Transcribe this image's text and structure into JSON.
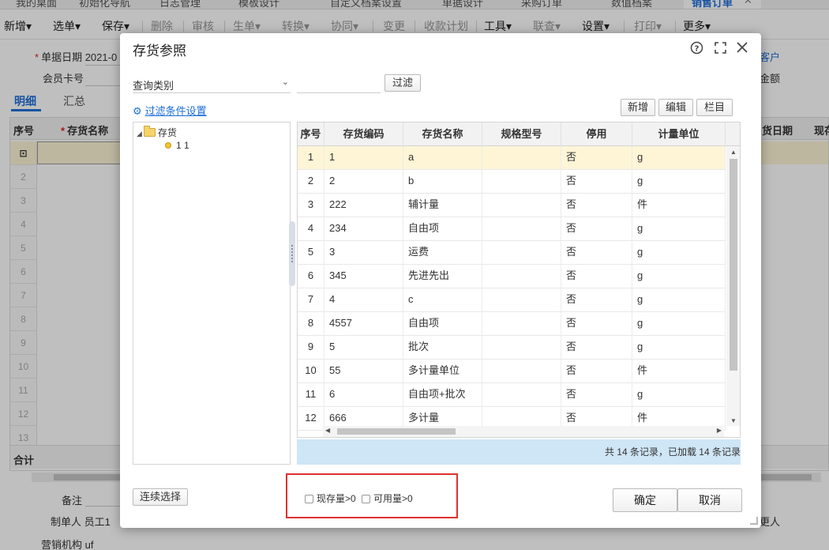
{
  "app_tabs": [
    "我的桌面",
    "初始化导航",
    "日志管理",
    "模板设计",
    "自定义档案设置",
    "单据设计",
    "采购订单",
    "数值档案",
    "销售订单"
  ],
  "toolbar": {
    "items": [
      {
        "label": "新增",
        "caret": "▾",
        "disabled": false
      },
      {
        "label": "选单",
        "caret": "▾",
        "disabled": false
      },
      {
        "label": "保存",
        "caret": "▾",
        "disabled": false
      },
      {
        "label": "删除",
        "caret": "",
        "disabled": true
      },
      {
        "label": "审核",
        "caret": "",
        "disabled": true
      },
      {
        "label": "生单",
        "caret": "▾",
        "disabled": true
      },
      {
        "label": "转换",
        "caret": "▾",
        "disabled": true
      },
      {
        "label": "协同",
        "caret": "▾",
        "disabled": true
      },
      {
        "label": "变更",
        "caret": "",
        "disabled": true
      },
      {
        "label": "收款计划",
        "caret": "",
        "disabled": true
      },
      {
        "label": "工具",
        "caret": "▾",
        "disabled": false
      },
      {
        "label": "联查",
        "caret": "▾",
        "disabled": true
      },
      {
        "label": "设置",
        "caret": "▾",
        "disabled": false
      },
      {
        "label": "打印",
        "caret": "▾",
        "disabled": true
      },
      {
        "label": "更多",
        "caret": "▾",
        "disabled": false
      }
    ]
  },
  "form": {
    "date_label": "单据日期",
    "date_value": "2021-0",
    "member_card_label": "会员卡号",
    "right_label_1": "客户",
    "right_label_2": "金额"
  },
  "subtabs": [
    "明细",
    "汇总"
  ],
  "grid": {
    "col_seq": "序号",
    "col_name": "存货名称",
    "col_date": "货日期",
    "col_stock": "现存",
    "row_numbers": [
      "2",
      "3",
      "4",
      "5",
      "6",
      "7",
      "8",
      "9",
      "10",
      "11",
      "12",
      "13"
    ],
    "total_label": "合计"
  },
  "footer": {
    "remark_label": "备注",
    "creator_label": "制单人",
    "creator_value": "员工1",
    "org_label": "营销机构",
    "org_value": "uf",
    "right_label": "更人"
  },
  "dialog": {
    "title": "存货参照",
    "query_select": "查询类别",
    "filter_button": "过滤",
    "filter_settings_link": "过滤条件设置",
    "buttons": {
      "add": "新增",
      "edit": "编辑",
      "columns": "栏目"
    },
    "tree": {
      "root": "存货",
      "child": "1 1"
    },
    "table": {
      "headers": [
        "序号",
        "存货编码",
        "存货名称",
        "规格型号",
        "停用",
        "计量单位"
      ],
      "rows": [
        [
          "1",
          "1",
          "a",
          "",
          "否",
          "g"
        ],
        [
          "2",
          "2",
          "b",
          "",
          "否",
          "g"
        ],
        [
          "3",
          "222",
          "辅计量",
          "",
          "否",
          "件"
        ],
        [
          "4",
          "234",
          "自由项",
          "",
          "否",
          "g"
        ],
        [
          "5",
          "3",
          "运费",
          "",
          "否",
          "g"
        ],
        [
          "6",
          "345",
          "先进先出",
          "",
          "否",
          "g"
        ],
        [
          "7",
          "4",
          "c",
          "",
          "否",
          "g"
        ],
        [
          "8",
          "4557",
          "自由项",
          "",
          "否",
          "g"
        ],
        [
          "9",
          "5",
          "批次",
          "",
          "否",
          "g"
        ],
        [
          "10",
          "55",
          "多计量单位",
          "",
          "否",
          "件"
        ],
        [
          "11",
          "6",
          "自由项+批次",
          "",
          "否",
          "g"
        ],
        [
          "12",
          "666",
          "多计量",
          "",
          "否",
          "件"
        ]
      ]
    },
    "status_text": "共 14 条记录，已加载 14 条记录",
    "continuous_select": "连续选择",
    "checkbox_stock": "现存量>0",
    "checkbox_available": "可用量>0",
    "confirm": "确定",
    "cancel": "取消"
  },
  "colors": {
    "accent": "#1e6fd9",
    "selected_row": "#fdf5d6",
    "status_bar": "#cfe6f6",
    "highlight_box": "#e03030"
  }
}
